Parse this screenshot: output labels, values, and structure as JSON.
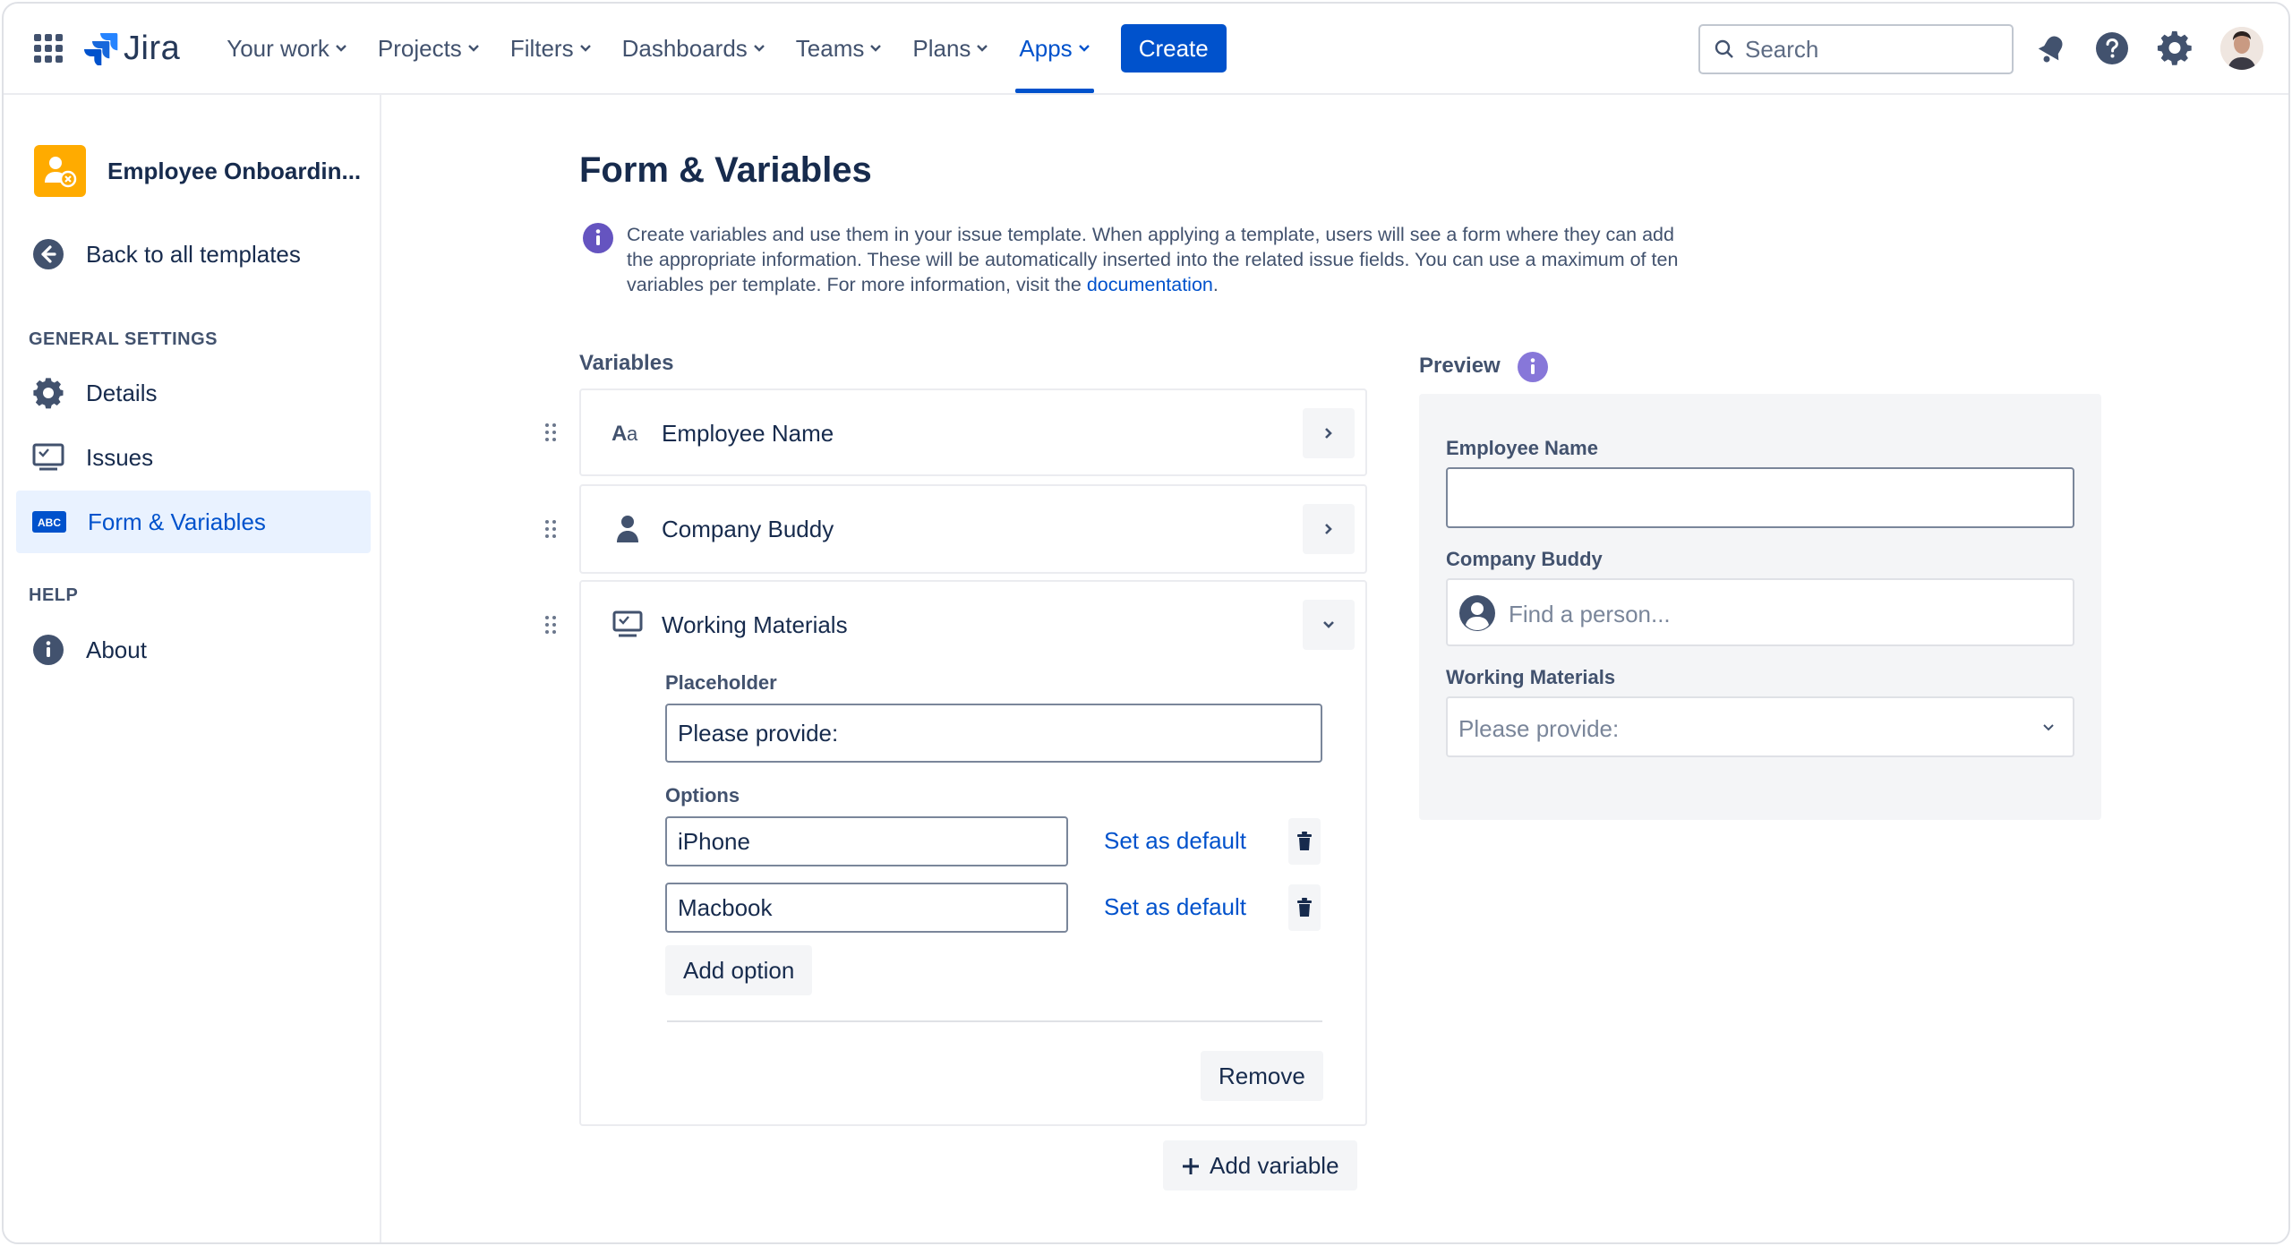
{
  "nav": {
    "logo_text": "Jira",
    "items": [
      {
        "label": "Your work"
      },
      {
        "label": "Projects"
      },
      {
        "label": "Filters"
      },
      {
        "label": "Dashboards"
      },
      {
        "label": "Teams"
      },
      {
        "label": "Plans"
      },
      {
        "label": "Apps",
        "active": true
      }
    ],
    "create_label": "Create",
    "search_placeholder": "Search"
  },
  "sidebar": {
    "project_name": "Employee Onboardin...",
    "back_link": "Back to all templates",
    "general_settings_heading": "GENERAL SETTINGS",
    "items": [
      {
        "label": "Details"
      },
      {
        "label": "Issues"
      },
      {
        "label": "Form & Variables",
        "selected": true
      }
    ],
    "help_heading": "HELP",
    "about_label": "About"
  },
  "main": {
    "title": "Form & Variables",
    "info_text": "Create variables and use them in your issue template. When applying a template, users will see a form where they can add the appropriate information. These will be automatically inserted into the related issue fields. You can use a maximum of ten variables per template. For more information, visit the ",
    "info_link": "documentation",
    "info_end": ".",
    "variables_heading": "Variables",
    "variables": [
      {
        "name": "Employee Name",
        "icon": "text-type-icon"
      },
      {
        "name": "Company Buddy",
        "icon": "person-icon"
      },
      {
        "name": "Working Materials",
        "icon": "screen-icon",
        "expanded": true
      }
    ],
    "expanded": {
      "placeholder_label": "Placeholder",
      "placeholder_value": "Please provide:",
      "options_label": "Options",
      "options": [
        {
          "value": "iPhone",
          "action": "Set as default"
        },
        {
          "value": "Macbook",
          "action": "Set as default"
        }
      ],
      "add_option_label": "Add option",
      "remove_label": "Remove"
    },
    "add_variable_label": "Add variable"
  },
  "preview": {
    "heading": "Preview",
    "fields": [
      {
        "label": "Employee Name",
        "value": ""
      },
      {
        "label": "Company Buddy",
        "placeholder": "Find a person..."
      },
      {
        "label": "Working Materials",
        "selected": "Please provide:"
      }
    ]
  },
  "colors": {
    "brand": "#0052CC",
    "info_purple": "#6554C0",
    "project_icon": "#FFAB00"
  }
}
